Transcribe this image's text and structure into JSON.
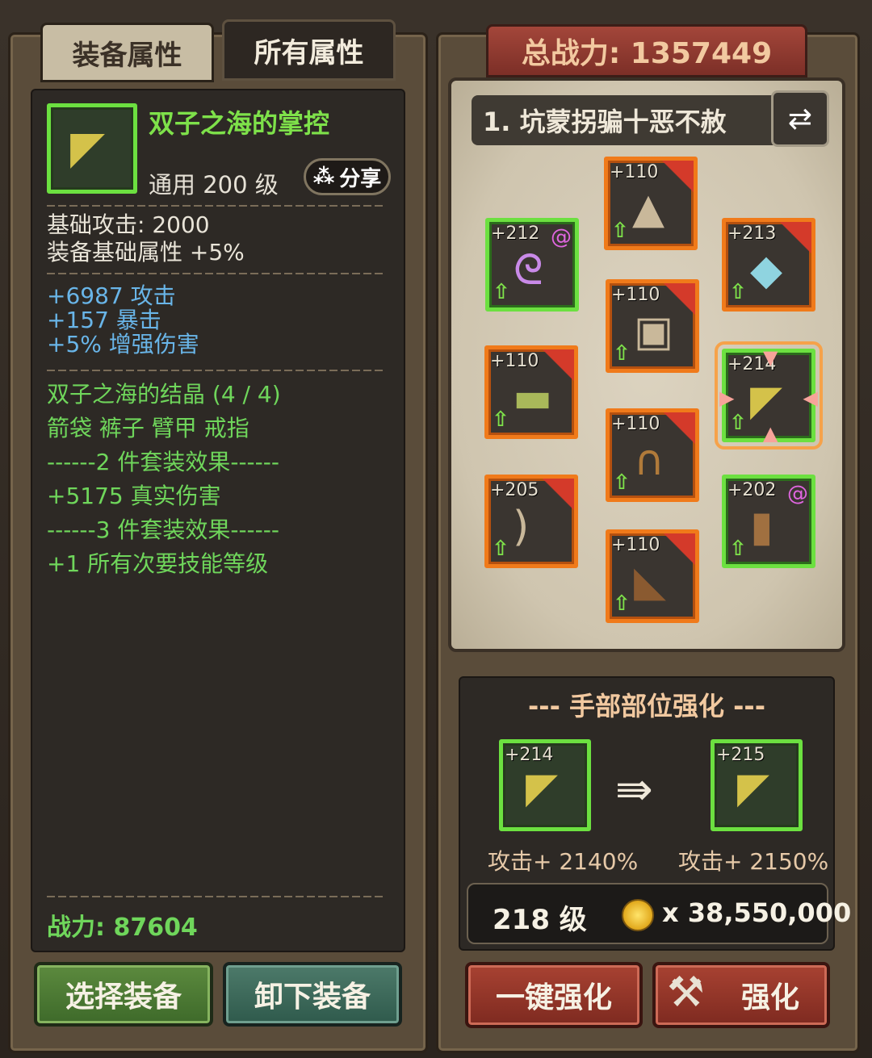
{
  "tabs": {
    "equip_attr": "装备属性",
    "all_attr": "所有属性"
  },
  "item": {
    "name": "双子之海的掌控",
    "type_level": "通用 200 级",
    "share_label": "分享",
    "base_attack": "基础攻击:  2000",
    "base_bonus": "装备基础属性 +5%",
    "bonus_stats": [
      "+6987 攻击",
      "+157 暴击",
      "+5% 增强伤害"
    ],
    "set_name": "双子之海的结晶 (4 / 4)",
    "set_parts": "箭袋 裤子 臂甲 戒指",
    "set_2_header": "------2 件套装效果------",
    "set_2_effect": "+5175 真实伤害",
    "set_3_header": "------3 件套装效果------",
    "set_3_effect": "+1 所有次要技能等级",
    "power": "战力:  87604"
  },
  "buttons": {
    "select_equip": "选择装备",
    "unequip": "卸下装备",
    "one_key_enhance": "一键强化",
    "enhance": "强化"
  },
  "total_power": "总战力:  1357449",
  "preset": "1. 坑蒙拐骗十恶不赦",
  "slots": [
    {
      "name": "slot-hat",
      "level": "+110",
      "frame": "orange",
      "icon": "wizard-hat-icon"
    },
    {
      "name": "slot-ring",
      "level": "+212",
      "frame": "green",
      "icon": "ring-icon"
    },
    {
      "name": "slot-amulet",
      "level": "+213",
      "frame": "orange",
      "icon": "amulet-icon"
    },
    {
      "name": "slot-armor",
      "level": "+110",
      "frame": "orange",
      "icon": "armor-icon"
    },
    {
      "name": "slot-quiver",
      "level": "+110",
      "frame": "orange",
      "icon": "quiver-icon"
    },
    {
      "name": "slot-bracer",
      "level": "+214",
      "frame": "green",
      "icon": "bracer-icon"
    },
    {
      "name": "slot-pants",
      "level": "+110",
      "frame": "orange",
      "icon": "pants-icon"
    },
    {
      "name": "slot-bow",
      "level": "+205",
      "frame": "orange",
      "icon": "bow-icon"
    },
    {
      "name": "slot-glove",
      "level": "+202",
      "frame": "green",
      "icon": "glove-icon"
    },
    {
      "name": "slot-boots",
      "level": "+110",
      "frame": "orange",
      "icon": "boots-icon"
    }
  ],
  "enhance": {
    "title": "--- 手部部位强化 ---",
    "from_level": "+214",
    "to_level": "+215",
    "from_stat": "攻击+ 2140%",
    "to_stat": "攻击+ 2150%",
    "required_level": "218 级",
    "cost": "x 38,550,000"
  }
}
